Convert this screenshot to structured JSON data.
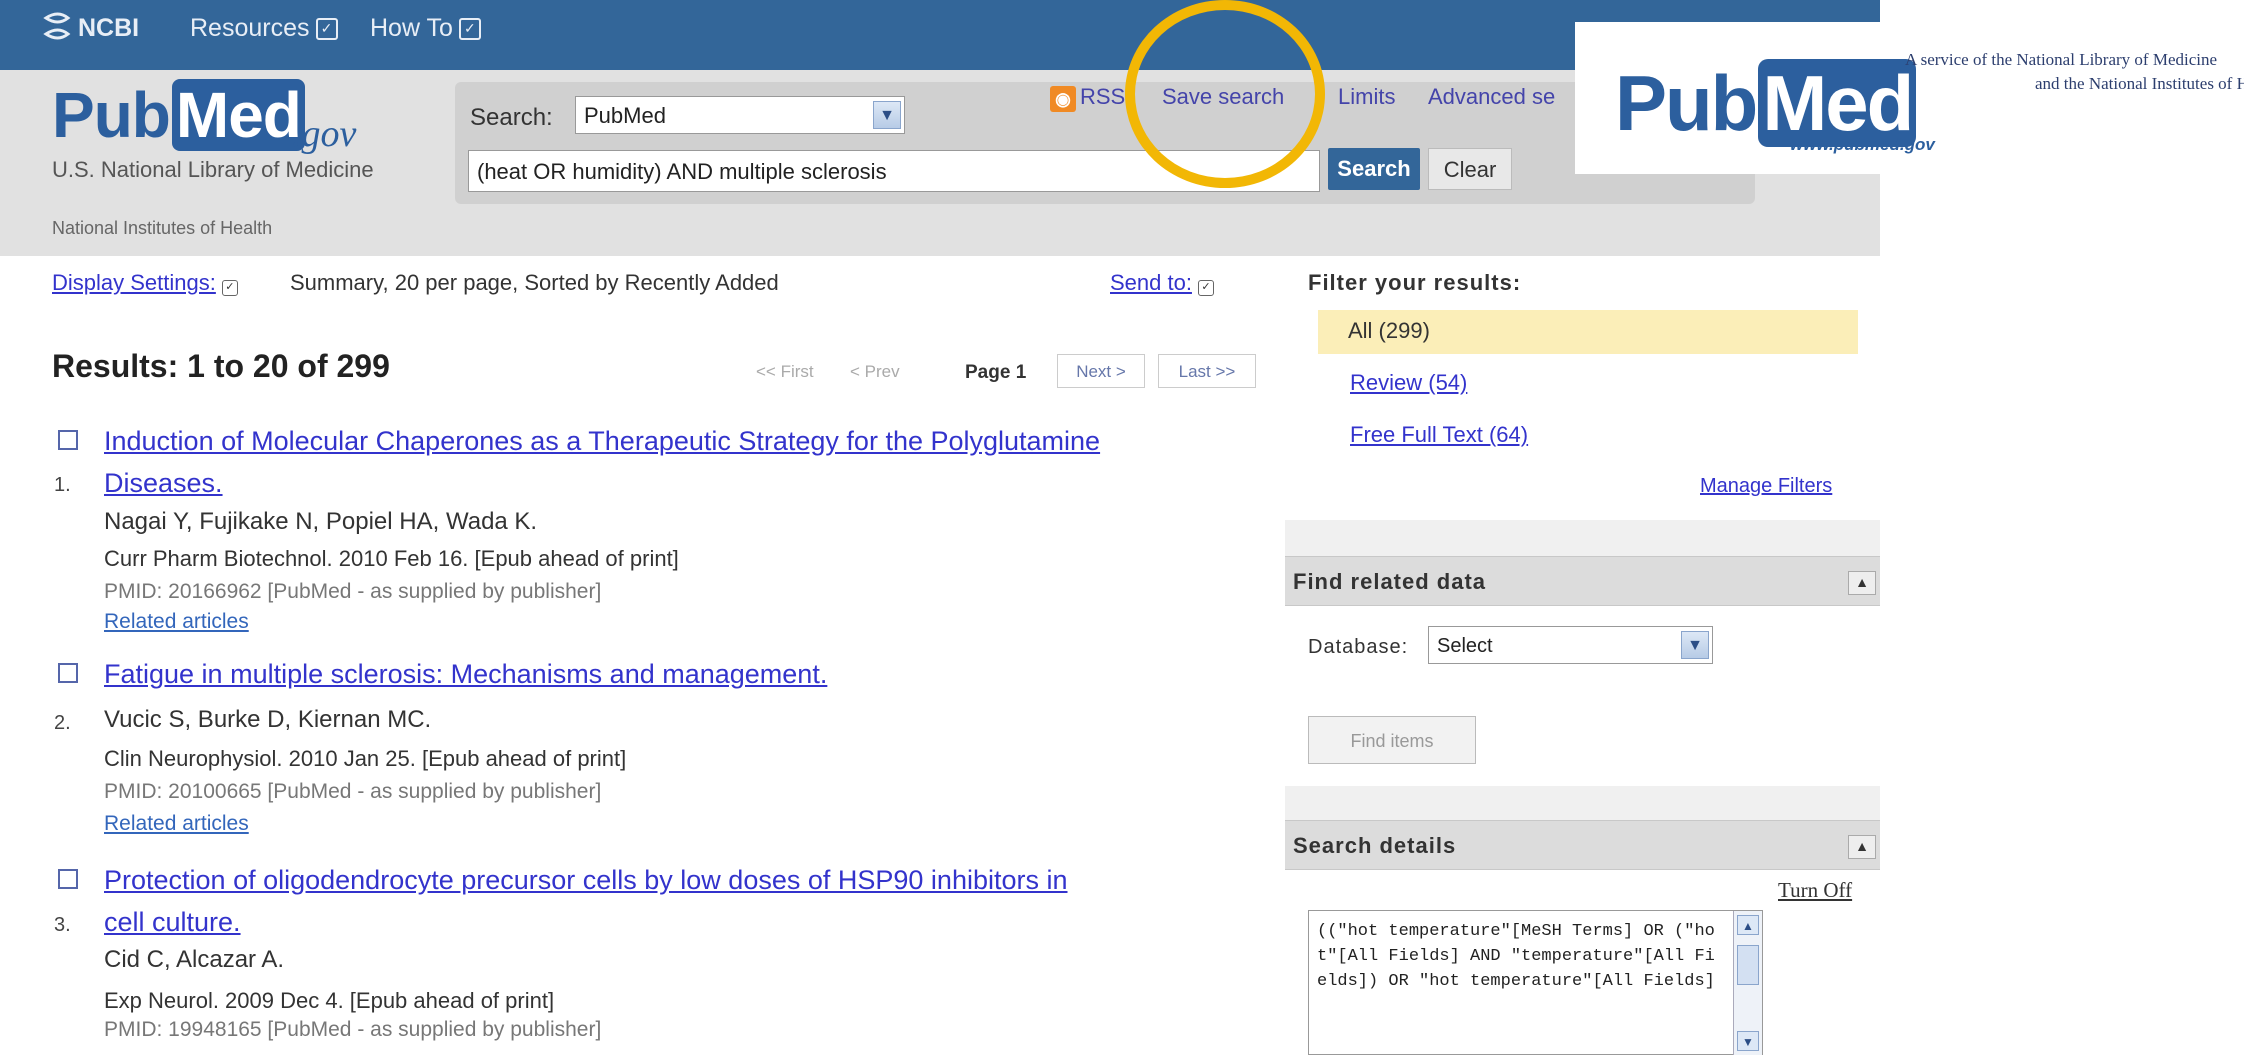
{
  "ncbi_bar": {
    "logo_text": "NCBI",
    "resources_label": "Resources",
    "howto_label": "How To",
    "checkbox_glyph": "✓"
  },
  "header": {
    "logo_pub": "Pub",
    "logo_med": "Med",
    "logo_gov": ".gov",
    "nlm": "U.S. National Library of Medicine",
    "nih": "National Institutes of Health",
    "search_label": "Search:",
    "database_value": "PubMed",
    "query_value": "(heat OR humidity) AND multiple sclerosis",
    "search_button": "Search",
    "clear_button": "Clear",
    "rss_label": "RSS",
    "save_search_label": "Save search",
    "limits_label": "Limits",
    "advanced_label": "Advanced se"
  },
  "overlay_logo": {
    "pub": "Pub",
    "med": "Med",
    "www": "www.pubmed.gov",
    "service_line1": "A service of the National Library of Medicine",
    "service_line2": "and the National Institutes of Health"
  },
  "display": {
    "settings_label": "Display Settings:",
    "settings_value": "Summary, 20 per page, Sorted by Recently Added",
    "send_to": "Send to:"
  },
  "results": {
    "title": "Results: 1 to 20 of 299",
    "pager": {
      "first": "<< First",
      "prev": "< Prev",
      "page": "Page 1",
      "next": "Next >",
      "last": "Last >>"
    },
    "items": [
      {
        "num": "1.",
        "title_line1": "Induction of Molecular Chaperones as a Therapeutic Strategy for the Polyglutamine",
        "title_line2": "Diseases.",
        "authors": "Nagai Y, Fujikake N, Popiel HA, Wada K.",
        "journal": "Curr Pharm Biotechnol. 2010 Feb 16. [Epub ahead of print]",
        "pmid": "PMID: 20166962 [PubMed - as supplied by publisher]",
        "related": "Related articles"
      },
      {
        "num": "2.",
        "title_line1": "Fatigue in multiple sclerosis: Mechanisms and management.",
        "title_line2": "",
        "authors": "Vucic S, Burke D, Kiernan MC.",
        "journal": "Clin Neurophysiol. 2010 Jan 25. [Epub ahead of print]",
        "pmid": "PMID: 20100665 [PubMed - as supplied by publisher]",
        "related": "Related articles"
      },
      {
        "num": "3.",
        "title_line1": "Protection of oligodendrocyte precursor cells by low doses of HSP90 inhibitors in",
        "title_line2": "cell culture.",
        "authors": "Cid C, Alcazar A.",
        "journal": "Exp Neurol. 2009 Dec 4. [Epub ahead of print]",
        "pmid": "PMID: 19948165 [PubMed - as supplied by publisher]",
        "related": ""
      }
    ]
  },
  "filters": {
    "title": "Filter your results:",
    "all": "All (299)",
    "review": "Review (54)",
    "free_full_text": "Free Full Text (64)",
    "manage": "Manage Filters"
  },
  "related_data": {
    "title": "Find related data",
    "database_label": "Database:",
    "database_value": "Select",
    "find_items": "Find items",
    "collapse_glyph": "▲"
  },
  "search_details": {
    "title": "Search details",
    "turn_off": "Turn Off",
    "text": "((\"hot temperature\"[MeSH Terms] OR (\"hot\"[All Fields] AND \"temperature\"[All Fields]) OR \"hot temperature\"[All Fields]"
  },
  "glyphs": {
    "dropdown": "▼",
    "scroll_up": "▲",
    "scroll_down": "▼"
  },
  "colors": {
    "ncbi_bar": "#336699",
    "highlight": "#f2b705",
    "filter_active": "#fbeeb8",
    "link": "#3333cc"
  }
}
